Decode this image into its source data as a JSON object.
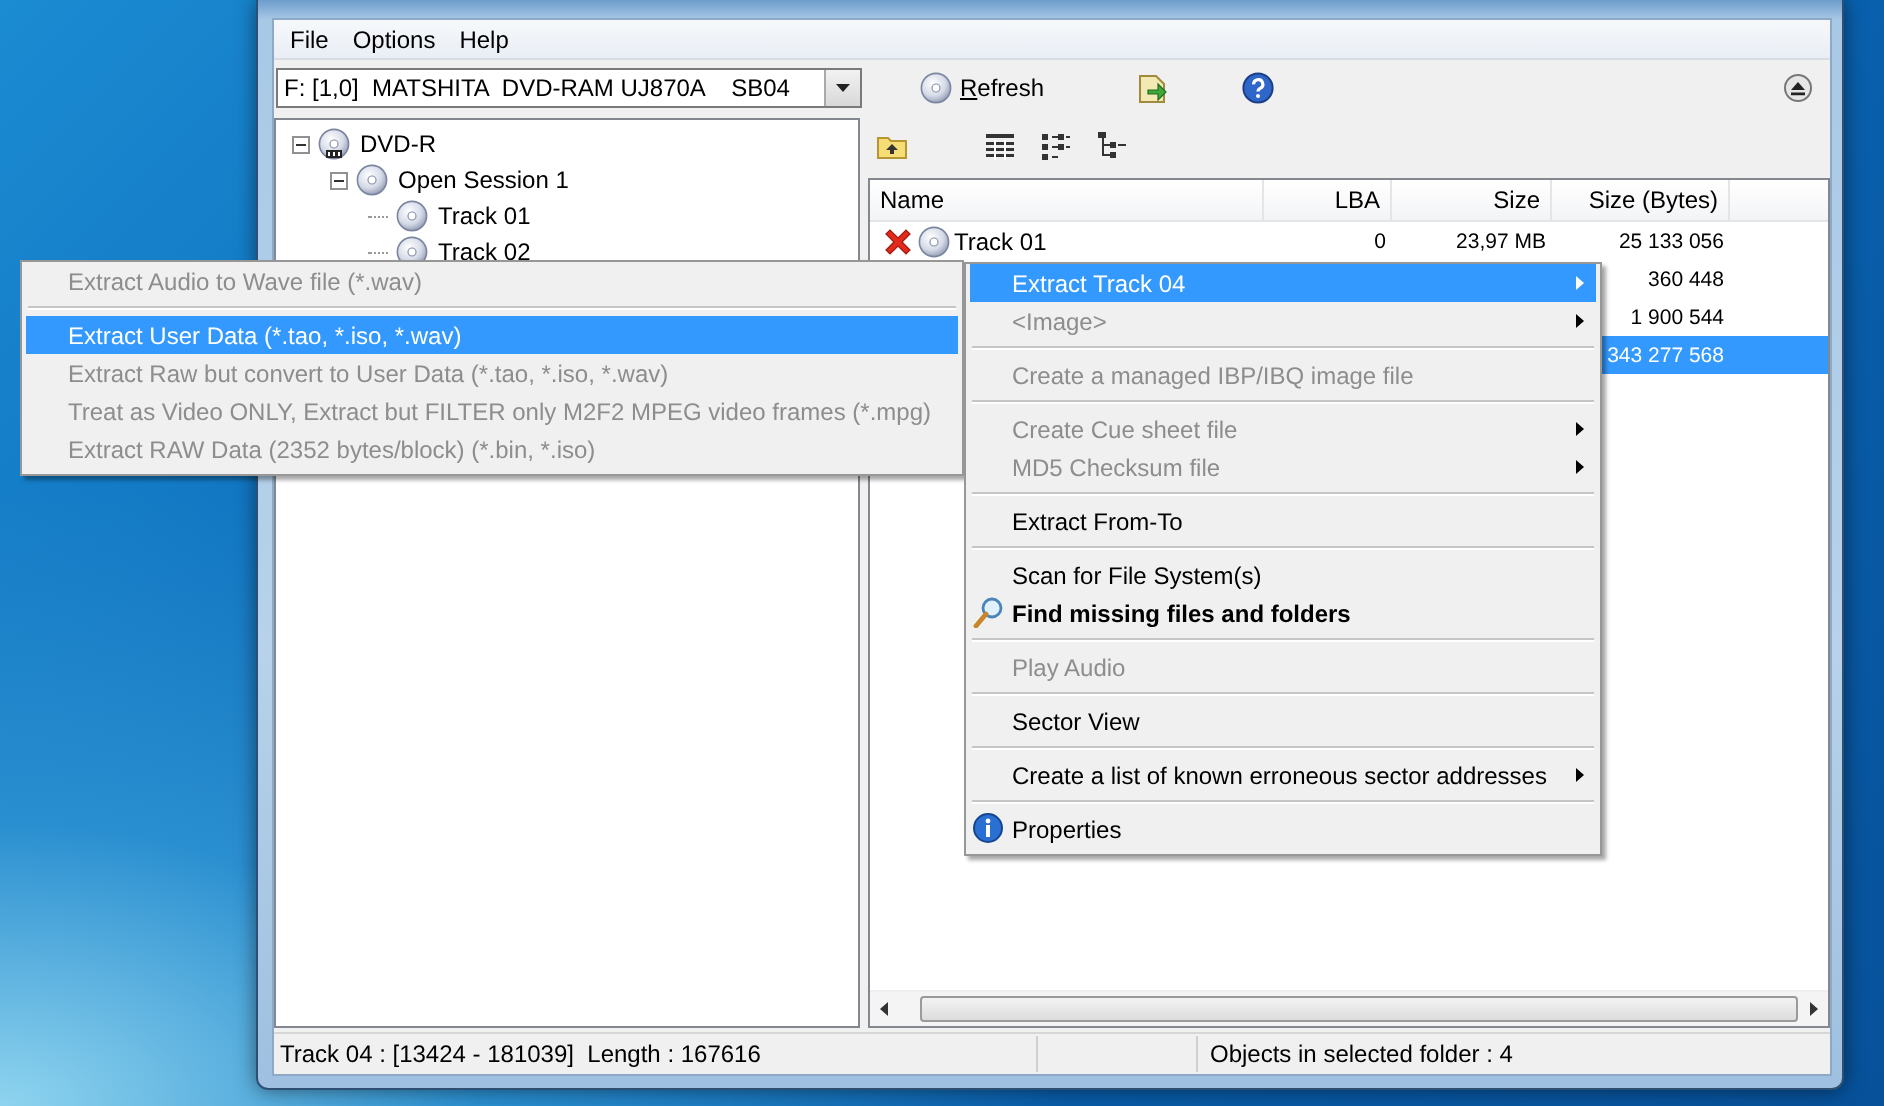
{
  "menu_bar": [
    "File",
    "Options",
    "Help"
  ],
  "toolbar": {
    "drive": "F: [1,0]  MATSHITA  DVD-RAM UJ870A    SB04",
    "refresh": "Refresh"
  },
  "tree": [
    {
      "label": "DVD-R",
      "kind": "drive",
      "expanded": true,
      "children": [
        {
          "label": "Open Session 1",
          "expanded": true,
          "children": [
            {
              "label": "Track 01"
            },
            {
              "label": "Track 02"
            }
          ]
        }
      ]
    }
  ],
  "list": {
    "columns": [
      "Name",
      "LBA",
      "Size",
      "Size (Bytes)"
    ],
    "rows": [
      {
        "name": "Track 01",
        "lba": "0",
        "size": "23,97 MB",
        "bytes": "25 133 056",
        "error": true,
        "selected": false
      },
      {
        "bytes": "360 448",
        "selected": false
      },
      {
        "bytes": "1 900 544",
        "selected": false
      },
      {
        "bytes": "343 277 568",
        "selected": true
      }
    ]
  },
  "context_menu": {
    "items": [
      {
        "kind": "item",
        "label": "Extract Track 04",
        "selected": true,
        "disabled": false,
        "has_submenu": true
      },
      {
        "kind": "item",
        "label": "<Image>",
        "selected": false,
        "disabled": true,
        "has_submenu": true
      },
      {
        "kind": "separator"
      },
      {
        "kind": "item",
        "label": "Create a managed IBP/IBQ image file",
        "selected": false,
        "disabled": true,
        "has_submenu": false
      },
      {
        "kind": "separator"
      },
      {
        "kind": "item",
        "label": "Create Cue sheet file",
        "selected": false,
        "disabled": true,
        "has_submenu": true
      },
      {
        "kind": "item",
        "label": "MD5 Checksum file",
        "selected": false,
        "disabled": true,
        "has_submenu": true
      },
      {
        "kind": "separator"
      },
      {
        "kind": "item",
        "label": "Extract From-To",
        "selected": false,
        "disabled": false,
        "has_submenu": false
      },
      {
        "kind": "separator"
      },
      {
        "kind": "item",
        "label": "Scan for File System(s)",
        "selected": false,
        "disabled": false,
        "has_submenu": false
      },
      {
        "kind": "find",
        "label": "Find missing files and folders",
        "selected": false,
        "disabled": false,
        "has_submenu": false
      },
      {
        "kind": "separator"
      },
      {
        "kind": "item",
        "label": "Play Audio",
        "selected": false,
        "disabled": true,
        "has_submenu": false
      },
      {
        "kind": "separator"
      },
      {
        "kind": "item",
        "label": "Sector View",
        "selected": false,
        "disabled": false,
        "has_submenu": false
      },
      {
        "kind": "separator"
      },
      {
        "kind": "item",
        "label": "Create a list of known erroneous sector addresses",
        "selected": false,
        "disabled": false,
        "has_submenu": true
      },
      {
        "kind": "separator"
      },
      {
        "kind": "info",
        "label": "Properties",
        "selected": false,
        "disabled": false,
        "has_submenu": false
      }
    ]
  },
  "submenu": {
    "items": [
      {
        "kind": "item",
        "label": "Extract Audio to Wave file (*.wav)",
        "selected": false,
        "disabled": true
      },
      {
        "kind": "separator"
      },
      {
        "kind": "item",
        "label": "Extract User Data (*.tao, *.iso, *.wav)",
        "selected": true,
        "disabled": false
      },
      {
        "kind": "item",
        "label": "Extract Raw but convert to User Data (*.tao, *.iso, *.wav)",
        "selected": false,
        "disabled": true
      },
      {
        "kind": "item",
        "label": "Treat as Video ONLY, Extract but FILTER only M2F2 MPEG video frames (*.mpg)",
        "selected": false,
        "disabled": true
      },
      {
        "kind": "item",
        "label": "Extract RAW Data (2352 bytes/block) (*.bin, *.iso)",
        "selected": false,
        "disabled": true
      }
    ]
  },
  "status_bar": [
    "Track 04 : [13424 - 181039]  Length : 167616",
    "Objects in selected folder : 4"
  ]
}
